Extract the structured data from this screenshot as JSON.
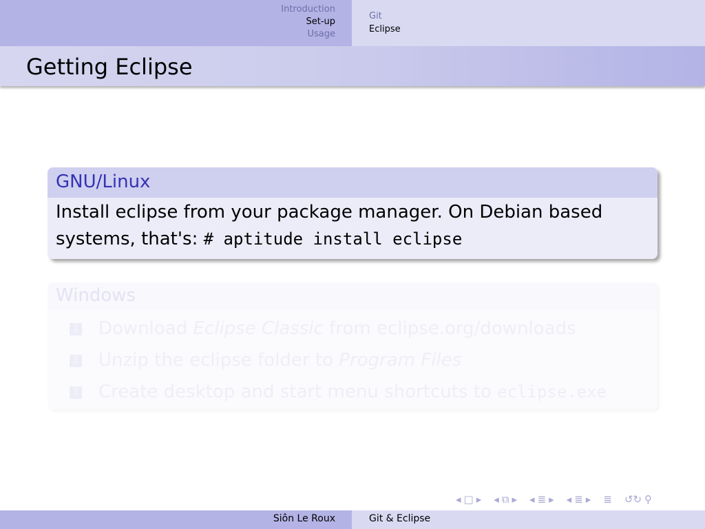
{
  "nav": {
    "sections": [
      "Introduction",
      "Set-up",
      "Usage"
    ],
    "active_section": "Set-up",
    "subsections": [
      "Git",
      "Eclipse"
    ],
    "active_subsection": "Eclipse"
  },
  "frame": {
    "title": "Getting Eclipse"
  },
  "block_linux": {
    "title": "GNU/Linux",
    "line1": "Install eclipse from your package manager.  On Debian based",
    "line2_text": "systems, that's: ",
    "line2_code": "# aptitude install eclipse"
  },
  "block_windows": {
    "title": "Windows",
    "items": [
      {
        "num": "1",
        "pre": "Download ",
        "em": "Eclipse Classic",
        "post": " from eclipse.org/downloads",
        "code": ""
      },
      {
        "num": "2",
        "pre": "Unzip the eclipse folder to ",
        "em": "Program Files",
        "post": "",
        "code": ""
      },
      {
        "num": "3",
        "pre": "Create desktop and start menu shortcuts to ",
        "em": "",
        "post": "",
        "code": "eclipse.exe"
      }
    ]
  },
  "footer": {
    "author": "Siôn Le Roux",
    "short_title": "Git & Eclipse"
  },
  "navsymbols": {
    "left": "◂",
    "right": "▸",
    "frame": "□",
    "subsection": "⧉",
    "section": "≣",
    "search": "⚲",
    "back_forward": "↺↻"
  },
  "colors": {
    "nav_dark": "#b3b3e6",
    "nav_light": "#d9d9f2",
    "block_title": "#3333b3",
    "block_header": "#cfcfef",
    "block_body": "#ececf9"
  }
}
